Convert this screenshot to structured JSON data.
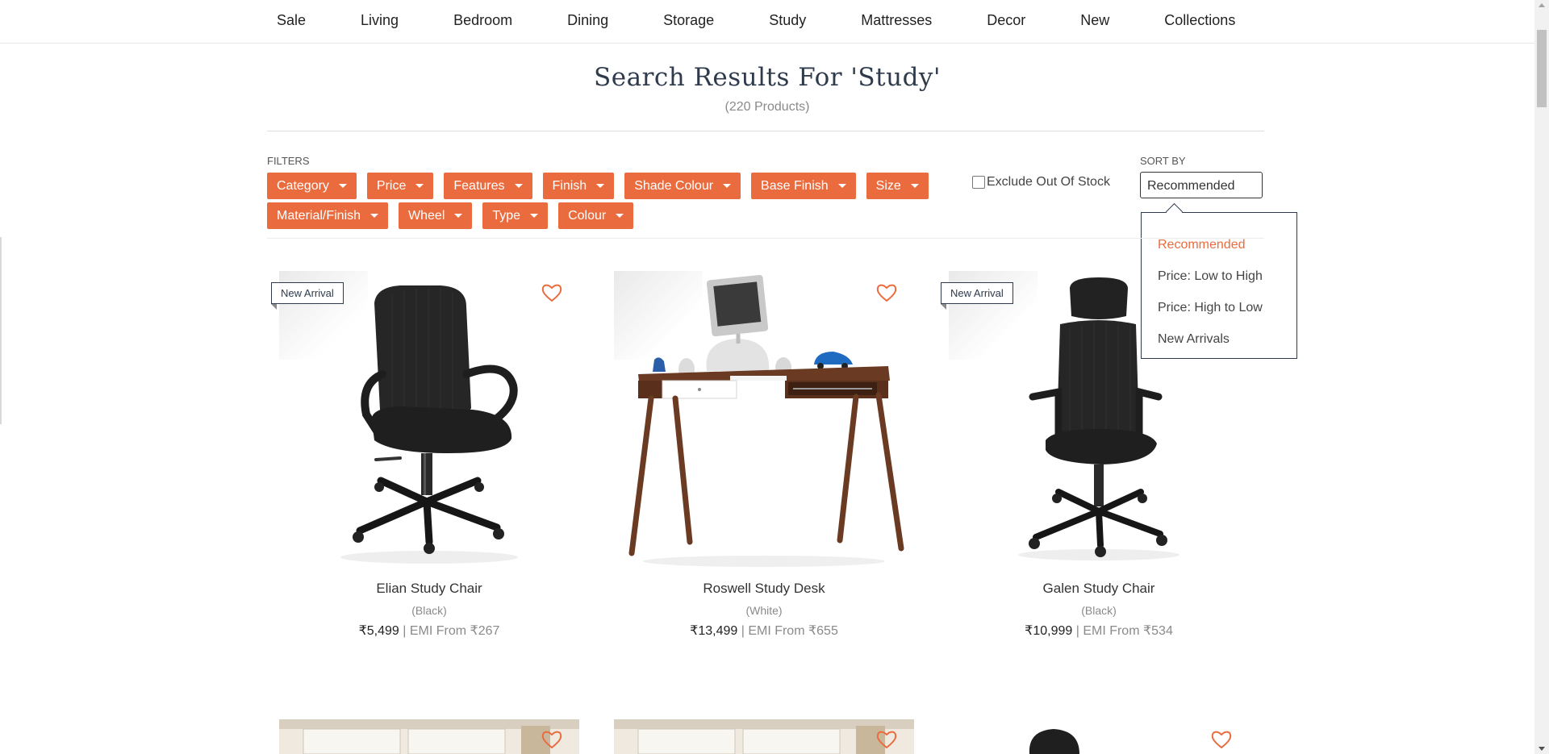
{
  "nav": {
    "items": [
      "Sale",
      "Living",
      "Bedroom",
      "Dining",
      "Storage",
      "Study",
      "Mattresses",
      "Decor",
      "New",
      "Collections"
    ]
  },
  "header": {
    "title": "Search Results For 'Study'",
    "count": "(220 Products)"
  },
  "filters": {
    "label": "FILTERS",
    "chips": [
      "Category",
      "Price",
      "Features",
      "Finish",
      "Shade Colour",
      "Base Finish",
      "Size",
      "Material/Finish",
      "Wheel",
      "Type",
      "Colour"
    ],
    "exclude_label": "Exclude Out Of Stock",
    "exclude_checked": false
  },
  "sort": {
    "label": "SORT BY",
    "selected": "Recommended",
    "options": [
      "Recommended",
      "Price: Low to High",
      "Price: High to Low",
      "New Arrivals"
    ]
  },
  "products": [
    {
      "badge": "New Arrival",
      "name": "Elian Study Chair",
      "color": "(Black)",
      "price": "₹5,499",
      "sep": " | ",
      "emi": "EMI From ₹267"
    },
    {
      "badge": "",
      "name": "Roswell Study Desk",
      "color": "(White)",
      "price": "₹13,499",
      "sep": " | ",
      "emi": "EMI From ₹655"
    },
    {
      "badge": "New Arrival",
      "name": "Galen Study Chair",
      "color": "(Black)",
      "price": "₹10,999",
      "sep": " | ",
      "emi": "EMI From ₹534"
    }
  ],
  "colors": {
    "accent": "#ea6c3e",
    "navy": "#2f3b4c"
  },
  "icons": {
    "wishlist": "heart-outline-icon",
    "dropdown": "caret-down-icon"
  }
}
